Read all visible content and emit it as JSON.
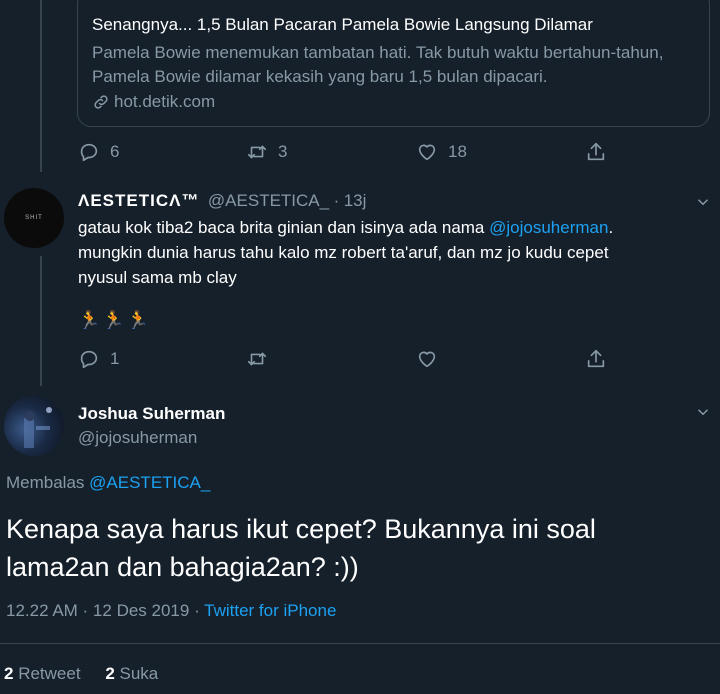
{
  "link_card": {
    "title": "Senangnya... 1,5 Bulan Pacaran Pamela Bowie Langsung Dilamar",
    "description": "Pamela Bowie menemukan tambatan hati. Tak butuh waktu bertahun-tahun, Pamela Bowie dilamar kekasih yang baru 1,5 bulan dipacari.",
    "domain": "hot.detik.com"
  },
  "first_tweet_actions": {
    "replies": "6",
    "retweets": "3",
    "likes": "18"
  },
  "reply_tweet": {
    "avatar_text": "SHIT",
    "display_name": "ΛESTETICΛ™",
    "handle": "@AESTETICA_",
    "separator": "·",
    "time": "13j",
    "text_before": "gatau kok tiba2 baca brita ginian dan isinya ada nama ",
    "mention": "@jojosuherman",
    "text_after": ".",
    "line2": "mungkin dunia harus tahu kalo mz robert ta'aruf, dan mz jo kudu cepet",
    "line3": "nyusul sama mb clay",
    "emojis": "🏃🏃🏃",
    "replies": "1"
  },
  "main_tweet": {
    "display_name": "Joshua Suherman",
    "handle": "@jojosuherman",
    "replying_label": "Membalas",
    "replying_to": "@AESTETICA_",
    "text_line1": "Kenapa saya harus ikut cepet? Bukannya ini soal",
    "text_line2": "lama2an dan bahagia2an? :))",
    "timestamp": "12.22 AM · 12 Des 2019 · ",
    "source": "Twitter for iPhone",
    "retweet_count": "2",
    "retweet_label": "Retweet",
    "like_count": "2",
    "like_label": "Suka"
  },
  "colors": {
    "background": "#15202b",
    "muted": "#8899a6",
    "accent": "#1da1f2",
    "border": "#38444d"
  }
}
